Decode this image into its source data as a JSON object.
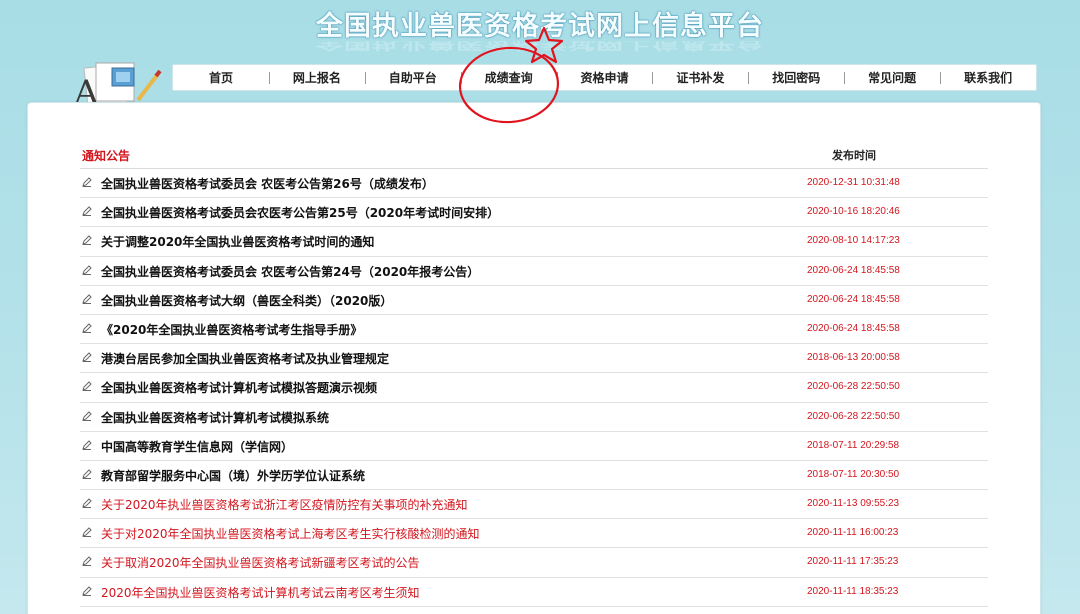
{
  "site": {
    "title": "全国执业兽医资格考试网上信息平台"
  },
  "nav": {
    "items": [
      "首页",
      "网上报名",
      "自助平台",
      "成绩查询",
      "资格申请",
      "证书补发",
      "找回密码",
      "常见问题",
      "联系我们"
    ],
    "highlighted": "成绩查询"
  },
  "notices": {
    "heading": "通知公告",
    "date_heading": "发布时间",
    "rows": [
      {
        "title": "全国执业兽医资格考试委员会 农医考公告第26号（成绩发布）",
        "date": "2020-12-31 10:31:48",
        "style": "bold"
      },
      {
        "title": "全国执业兽医资格考试委员会农医考公告第25号（2020年考试时间安排）",
        "date": "2020-10-16 18:20:46",
        "style": "bold"
      },
      {
        "title": "关于调整2020年全国执业兽医资格考试时间的通知",
        "date": "2020-08-10 14:17:23",
        "style": "bold"
      },
      {
        "title": "全国执业兽医资格考试委员会 农医考公告第24号（2020年报考公告）",
        "date": "2020-06-24 18:45:58",
        "style": "bold"
      },
      {
        "title": "全国执业兽医资格考试大纲（兽医全科类）（2020版）",
        "date": "2020-06-24 18:45:58",
        "style": "bold"
      },
      {
        "title": "《2020年全国执业兽医资格考试考生指导手册》",
        "date": "2020-06-24 18:45:58",
        "style": "bold"
      },
      {
        "title": "港澳台居民参加全国执业兽医资格考试及执业管理规定",
        "date": "2018-06-13 20:00:58",
        "style": "bold"
      },
      {
        "title": "全国执业兽医资格考试计算机考试模拟答题演示视频",
        "date": "2020-06-28 22:50:50",
        "style": "bold"
      },
      {
        "title": "全国执业兽医资格考试计算机考试模拟系统",
        "date": "2020-06-28 22:50:50",
        "style": "bold"
      },
      {
        "title": "中国高等教育学生信息网（学信网）",
        "date": "2018-07-11 20:29:58",
        "style": "bold"
      },
      {
        "title": "教育部留学服务中心国（境）外学历学位认证系统",
        "date": "2018-07-11 20:30:50",
        "style": "bold"
      },
      {
        "title": "关于2020年执业兽医资格考试浙江考区疫情防控有关事项的补充通知",
        "date": "2020-11-13 09:55:23",
        "style": "red"
      },
      {
        "title": "关于对2020年全国执业兽医资格考试上海考区考生实行核酸检测的通知",
        "date": "2020-11-11 16:00:23",
        "style": "red"
      },
      {
        "title": "关于取消2020年全国执业兽医资格考试新疆考区考试的公告",
        "date": "2020-11-11 17:35:23",
        "style": "red"
      },
      {
        "title": "2020年全国执业兽医资格考试计算机考试云南考区考生须知",
        "date": "2020-11-11 18:35:23",
        "style": "red"
      }
    ]
  },
  "colors": {
    "accent_red": "#d2161e",
    "background": "#b6e2ea",
    "annotation_red": "#e0141e"
  },
  "icons": {
    "logo": "document-letter-a-icon",
    "bullet": "pencil-icon",
    "annotation_star": "star-icon",
    "annotation_circle": "circle-highlight"
  }
}
